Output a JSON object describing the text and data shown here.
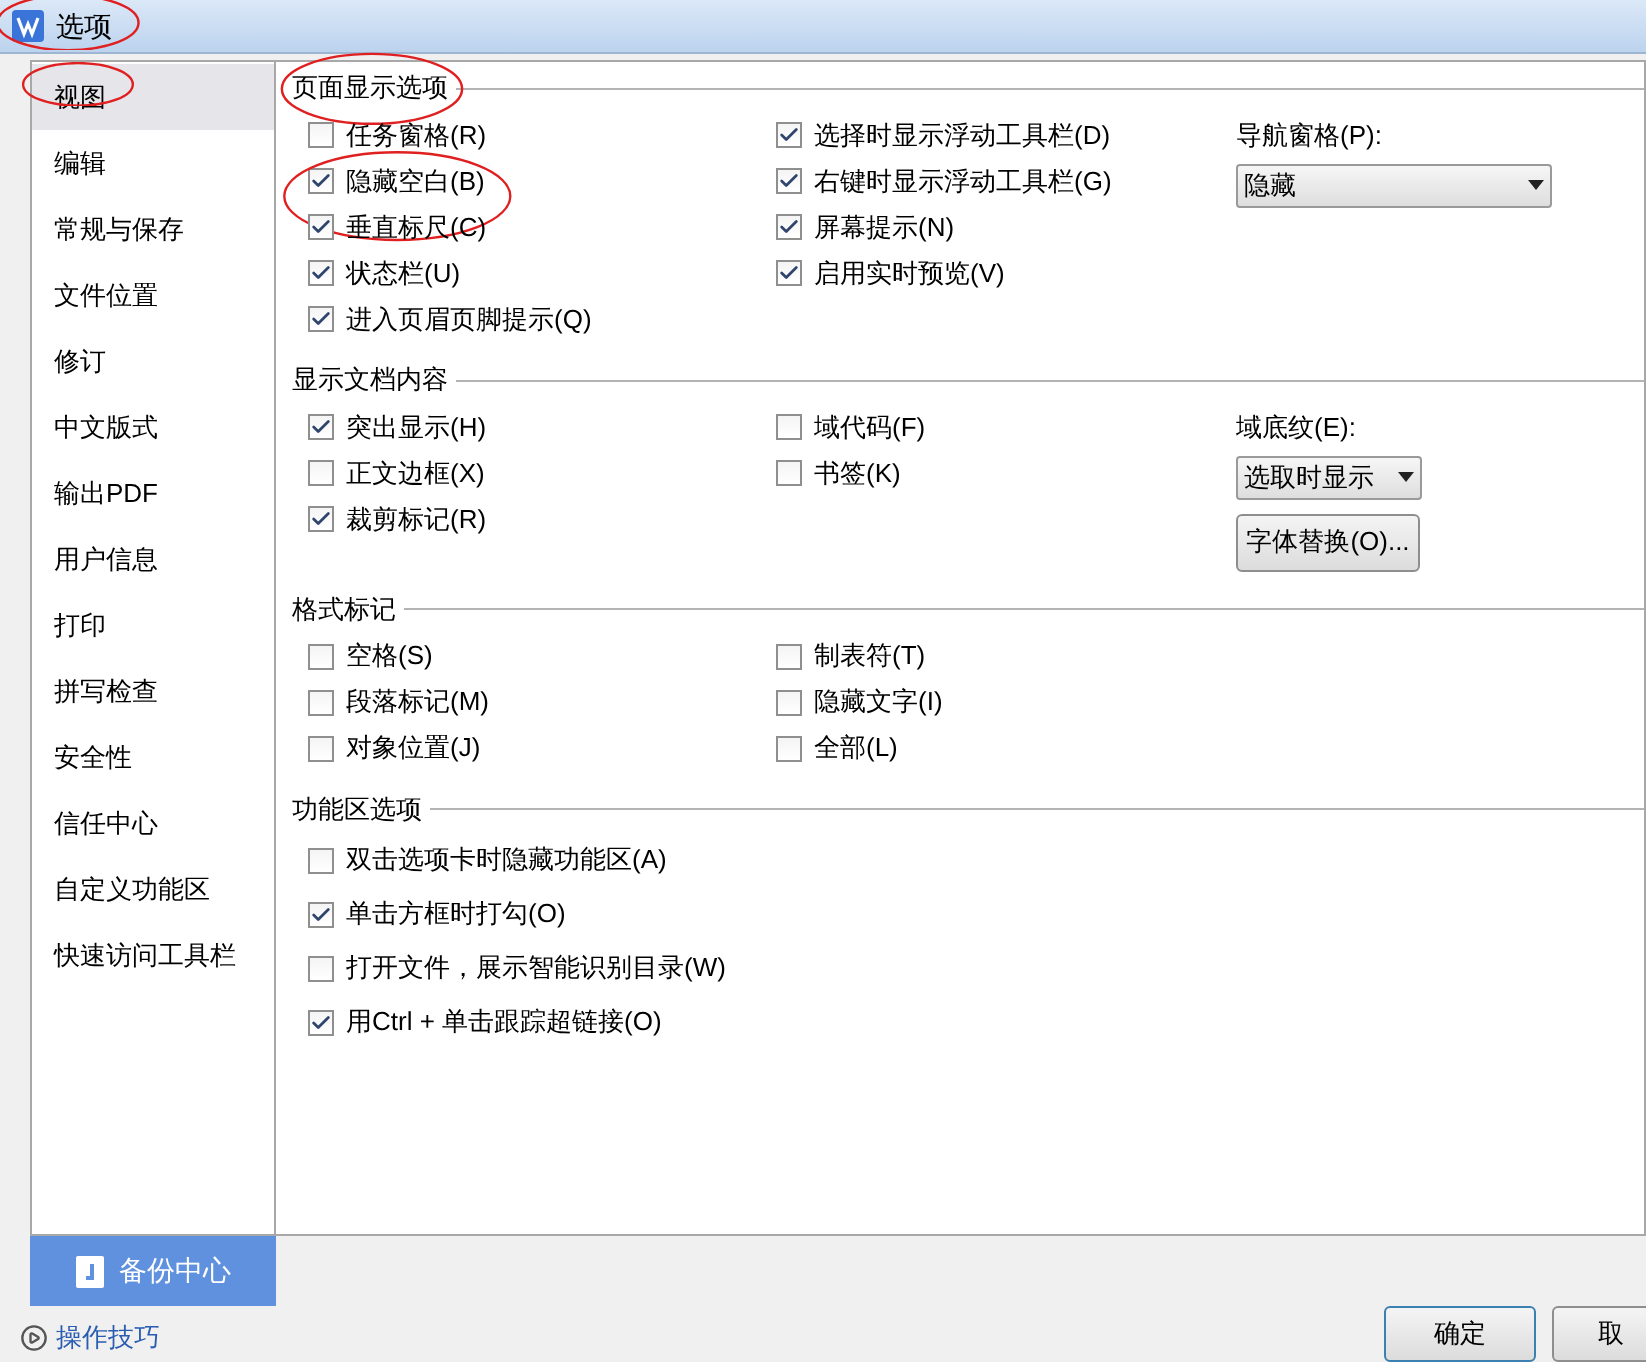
{
  "window": {
    "title": "选项",
    "circled": true
  },
  "sidebar": {
    "items": [
      {
        "label": "视图",
        "selected": true,
        "circled": true
      },
      {
        "label": "编辑",
        "selected": false,
        "circled": false
      },
      {
        "label": "常规与保存",
        "selected": false,
        "circled": false
      },
      {
        "label": "文件位置",
        "selected": false,
        "circled": false
      },
      {
        "label": "修订",
        "selected": false,
        "circled": false
      },
      {
        "label": "中文版式",
        "selected": false,
        "circled": false
      },
      {
        "label": "输出PDF",
        "selected": false,
        "circled": false
      },
      {
        "label": "用户信息",
        "selected": false,
        "circled": false
      },
      {
        "label": "打印",
        "selected": false,
        "circled": false
      },
      {
        "label": "拼写检查",
        "selected": false,
        "circled": false
      },
      {
        "label": "安全性",
        "selected": false,
        "circled": false
      },
      {
        "label": "信任中心",
        "selected": false,
        "circled": false
      },
      {
        "label": "自定义功能区",
        "selected": false,
        "circled": false
      },
      {
        "label": "快速访问工具栏",
        "selected": false,
        "circled": false
      }
    ],
    "backup_button": "备份中心"
  },
  "sections": [
    {
      "title": "页面显示选项",
      "circled": true,
      "columns": [
        [
          {
            "label": "任务窗格(R)",
            "checked": false,
            "circled": false
          },
          {
            "label": "隐藏空白(B)",
            "checked": true,
            "circled": true
          },
          {
            "label": "垂直标尺(C)",
            "checked": true,
            "circled": false
          },
          {
            "label": "状态栏(U)",
            "checked": true,
            "circled": false
          },
          {
            "label": "进入页眉页脚提示(Q)",
            "checked": true,
            "circled": false
          }
        ],
        [
          {
            "label": "选择时显示浮动工具栏(D)",
            "checked": true,
            "circled": false
          },
          {
            "label": "右键时显示浮动工具栏(G)",
            "checked": true,
            "circled": false
          },
          {
            "label": "屏幕提示(N)",
            "checked": true,
            "circled": false
          },
          {
            "label": "启用实时预览(V)",
            "checked": true,
            "circled": false
          }
        ]
      ],
      "side": {
        "label": "导航窗格(P):",
        "value": "隐藏",
        "kind": "wide"
      }
    },
    {
      "title": "显示文档内容",
      "circled": false,
      "columns": [
        [
          {
            "label": "突出显示(H)",
            "checked": true,
            "circled": false
          },
          {
            "label": "正文边框(X)",
            "checked": false,
            "circled": false
          },
          {
            "label": "裁剪标记(R)",
            "checked": true,
            "circled": false
          }
        ],
        [
          {
            "label": "域代码(F)",
            "checked": false,
            "circled": false
          },
          {
            "label": "书签(K)",
            "checked": false,
            "circled": false
          }
        ]
      ],
      "side": {
        "label": "域底纹(E):",
        "value": "选取时显示",
        "kind": "narrow",
        "button": "字体替换(O)..."
      }
    },
    {
      "title": "格式标记",
      "circled": false,
      "columns": [
        [
          {
            "label": "空格(S)",
            "checked": false,
            "circled": false
          },
          {
            "label": "段落标记(M)",
            "checked": false,
            "circled": false
          },
          {
            "label": "对象位置(J)",
            "checked": false,
            "circled": false
          }
        ],
        [
          {
            "label": "制表符(T)",
            "checked": false,
            "circled": false
          },
          {
            "label": "隐藏文字(I)",
            "checked": false,
            "circled": false
          },
          {
            "label": "全部(L)",
            "checked": false,
            "circled": false
          }
        ]
      ]
    },
    {
      "title": "功能区选项",
      "circled": false,
      "columns": [
        [
          {
            "label": "双击选项卡时隐藏功能区(A)",
            "checked": false,
            "circled": false
          },
          {
            "label": "单击方框时打勾(O)",
            "checked": true,
            "circled": false
          },
          {
            "label": "打开文件，展示智能识别目录(W)",
            "checked": false,
            "circled": false
          },
          {
            "label": "用Ctrl + 单击跟踪超链接(O)",
            "checked": true,
            "circled": false
          }
        ]
      ]
    }
  ],
  "footer": {
    "link": "操作技巧",
    "buttons": [
      "确定",
      "取"
    ]
  }
}
